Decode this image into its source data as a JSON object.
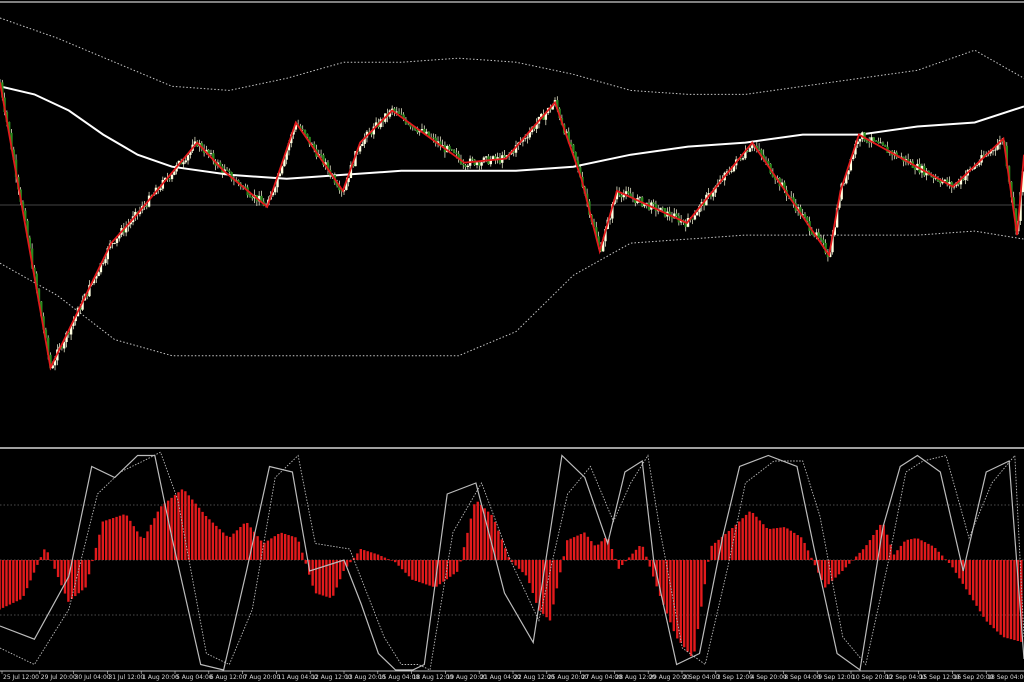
{
  "theme": {
    "background": "#000000",
    "bull_candle_color": "#ffffe0",
    "bear_candle_color": "#2b8a1e",
    "zigzag_color": "#e31a1c",
    "moving_average_color": "#ffffff",
    "band_color": "#c8c8c8",
    "histogram_color": "#e31a1c",
    "oscillator_line_color": "#bcbcbc",
    "panel_separator_color": "#ffffff",
    "axis_tick_color": "#d8d8d8"
  },
  "chart_data": [
    {
      "type": "candlestick",
      "panel": "price",
      "title": "",
      "grid": false,
      "legend": "none",
      "y_range": [
        0,
        100
      ],
      "zigzag": {
        "x_index": [
          0,
          44,
          97,
          119,
          172,
          195,
          233,
          258,
          299,
          314,
          342,
          405,
          441,
          484,
          507,
          523,
          538,
          599,
          656,
          723,
          733,
          749,
          831,
          875,
          887,
          893
        ],
        "y": [
          84,
          13,
          44,
          51,
          69,
          62,
          53,
          74,
          57,
          69,
          77,
          64,
          65,
          79,
          60,
          42,
          57,
          49,
          69,
          41,
          57,
          71,
          58,
          70,
          46,
          66
        ]
      },
      "moving_average": {
        "x_index": [
          0,
          30,
          60,
          90,
          120,
          150,
          200,
          250,
          300,
          350,
          400,
          450,
          500,
          550,
          600,
          650,
          700,
          750,
          800,
          850,
          893
        ],
        "y": [
          83,
          81,
          77,
          71,
          66,
          63,
          61,
          60,
          61,
          62,
          62,
          62,
          63,
          66,
          68,
          69,
          71,
          71,
          73,
          74,
          78
        ]
      },
      "upper_band": {
        "x_index": [
          0,
          50,
          100,
          150,
          200,
          250,
          300,
          350,
          400,
          450,
          500,
          550,
          600,
          650,
          700,
          750,
          800,
          850,
          893
        ],
        "y": [
          100,
          95,
          89,
          83,
          82,
          85,
          89,
          89,
          90,
          89,
          86,
          82,
          81,
          81,
          83,
          85,
          87,
          92,
          85
        ]
      },
      "lower_band": {
        "x_index": [
          0,
          50,
          100,
          150,
          200,
          250,
          300,
          350,
          400,
          450,
          500,
          550,
          600,
          650,
          700,
          750,
          800,
          850,
          893
        ],
        "y": [
          39,
          31,
          20,
          16,
          16,
          16,
          16,
          16,
          16,
          22,
          36,
          44,
          45,
          46,
          46,
          46,
          46,
          47,
          45
        ]
      }
    },
    {
      "type": "bar+line",
      "panel": "oscillator",
      "title": "",
      "grid": true,
      "legend": "none",
      "y_range": [
        -1,
        1
      ],
      "histogram": {
        "x_index": [
          0,
          20,
          40,
          60,
          75,
          90,
          110,
          125,
          140,
          160,
          180,
          200,
          215,
          230,
          245,
          260,
          275,
          290,
          300,
          315,
          330,
          345,
          360,
          380,
          400,
          415,
          430,
          445,
          460,
          470,
          480,
          495,
          510,
          520,
          530,
          540,
          560,
          575,
          590,
          605,
          620,
          640,
          655,
          670,
          685,
          700,
          720,
          735,
          755,
          770,
          780,
          790,
          800,
          815,
          830,
          845,
          860,
          875,
          893
        ],
        "y": [
          -0.45,
          -0.35,
          0.12,
          -0.38,
          -0.25,
          0.35,
          0.42,
          0.18,
          0.48,
          0.65,
          0.4,
          0.2,
          0.35,
          0.15,
          0.25,
          0.2,
          -0.3,
          -0.35,
          -0.1,
          0.1,
          0.05,
          -0.02,
          -0.18,
          -0.25,
          -0.1,
          0.55,
          0.4,
          0.0,
          -0.15,
          -0.45,
          -0.55,
          0.18,
          0.25,
          0.12,
          0.22,
          -0.08,
          0.15,
          -0.3,
          -0.7,
          -0.9,
          0.12,
          0.3,
          0.45,
          0.28,
          0.3,
          0.2,
          -0.25,
          -0.1,
          0.12,
          0.35,
          0.05,
          0.18,
          0.2,
          0.12,
          -0.05,
          -0.3,
          -0.55,
          -0.7,
          -0.75
        ]
      },
      "line_main": {
        "x_index": [
          0,
          30,
          60,
          80,
          100,
          120,
          135,
          150,
          175,
          195,
          215,
          235,
          255,
          270,
          300,
          315,
          330,
          345,
          360,
          370,
          390,
          415,
          440,
          465,
          490,
          510,
          530,
          545,
          560,
          570,
          590,
          610,
          630,
          645,
          670,
          695,
          710,
          730,
          750,
          770,
          785,
          800,
          820,
          840,
          860,
          880,
          893
        ],
        "y": [
          -0.6,
          -0.72,
          -0.15,
          0.85,
          0.75,
          0.95,
          0.95,
          0.2,
          -0.95,
          -1.0,
          -0.1,
          0.85,
          0.8,
          -0.1,
          0.0,
          -0.4,
          -0.85,
          -1.0,
          -1.0,
          -0.95,
          0.6,
          0.7,
          -0.3,
          -0.75,
          0.95,
          0.75,
          0.15,
          0.8,
          0.9,
          0.0,
          -0.95,
          -0.85,
          0.2,
          0.85,
          0.95,
          0.85,
          0.1,
          -0.85,
          -1.0,
          0.3,
          0.85,
          0.95,
          0.8,
          -0.1,
          0.8,
          0.9,
          -0.9
        ]
      },
      "line_signal": {
        "x_index": [
          0,
          30,
          60,
          85,
          105,
          125,
          140,
          155,
          180,
          200,
          220,
          240,
          260,
          275,
          305,
          320,
          335,
          350,
          365,
          375,
          395,
          420,
          445,
          470,
          495,
          515,
          535,
          550,
          565,
          575,
          595,
          615,
          635,
          650,
          675,
          700,
          715,
          735,
          755,
          775,
          790,
          805,
          825,
          845,
          865,
          885,
          893
        ],
        "y": [
          -0.8,
          -0.95,
          -0.45,
          0.6,
          0.8,
          0.9,
          0.98,
          0.55,
          -0.85,
          -0.95,
          -0.45,
          0.75,
          0.95,
          0.15,
          0.1,
          -0.3,
          -0.7,
          -0.95,
          -0.95,
          -1.0,
          0.25,
          0.7,
          0.0,
          -0.55,
          0.6,
          0.85,
          0.35,
          0.7,
          0.95,
          0.3,
          -0.8,
          -0.95,
          -0.05,
          0.7,
          0.9,
          0.9,
          0.4,
          -0.7,
          -0.95,
          0.0,
          0.8,
          0.9,
          0.95,
          0.2,
          0.7,
          0.95,
          -0.7
        ]
      },
      "reference_levels": [
        0.5,
        0,
        -0.5
      ]
    }
  ],
  "x_axis": {
    "tick_labels": [
      "25 Jul 12:00",
      "29 Jul 20:00",
      "30 Jul 04:00",
      "31 Jul 12:00",
      "1 Aug 20:00",
      "5 Aug 04:00",
      "6 Aug 12:00",
      "7 Aug 20:00",
      "11 Aug 04:00",
      "12 Aug 12:00",
      "13 Aug 20:00",
      "15 Aug 04:00",
      "18 Aug 12:00",
      "19 Aug 20:00",
      "21 Aug 04:00",
      "22 Aug 12:00",
      "25 Aug 20:00",
      "27 Aug 04:00",
      "28 Aug 12:00",
      "29 Aug 20:00",
      "2 Sep 04:00",
      "3 Sep 12:00",
      "4 Sep 20:00",
      "8 Sep 04:00",
      "9 Sep 12:00",
      "10 Sep 20:00",
      "12 Sep 04:00",
      "15 Sep 12:00",
      "16 Sep 20:00",
      "18 Sep 04:00"
    ]
  }
}
